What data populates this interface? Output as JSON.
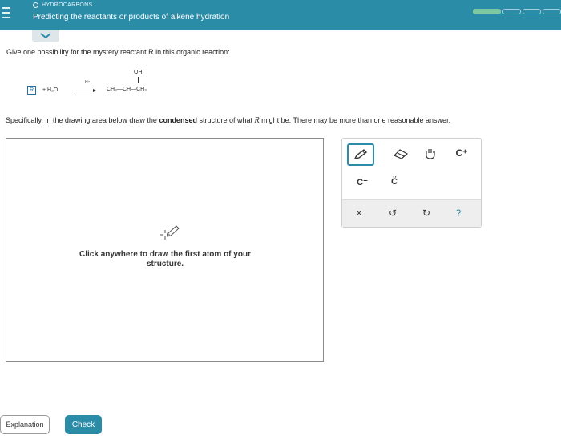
{
  "header": {
    "topic": "HYDROCARBONS",
    "title": "Predicting the reactants or products of alkene hydration"
  },
  "question": {
    "prompt": "Give one possibility for the mystery reactant R in this organic reaction:",
    "reaction": {
      "reactant_box": "R",
      "plus_water": "+ H₂O",
      "arrow_label": "H⁺",
      "substituent": "OH",
      "product": "CH₃—CH—CH₃"
    },
    "instruction_1": "Specifically, in the drawing area below draw the ",
    "instruction_bold": "condensed",
    "instruction_2": " structure of what ",
    "instruction_var": "R",
    "instruction_3": " might be. There may be more than one reasonable answer."
  },
  "drawing_area": {
    "hint": "Click anywhere to draw the first atom of your structure."
  },
  "tools": {
    "cplus": "C⁺",
    "cminus": "C⁻",
    "clone": "C̈",
    "close": "×",
    "undo": "↺",
    "redo": "↻",
    "help": "?"
  },
  "footer": {
    "explanation_label": "Explanation",
    "check_label": "Check"
  },
  "colors": {
    "accent": "#2b8ca8",
    "progress_done": "#7cc9a2"
  }
}
